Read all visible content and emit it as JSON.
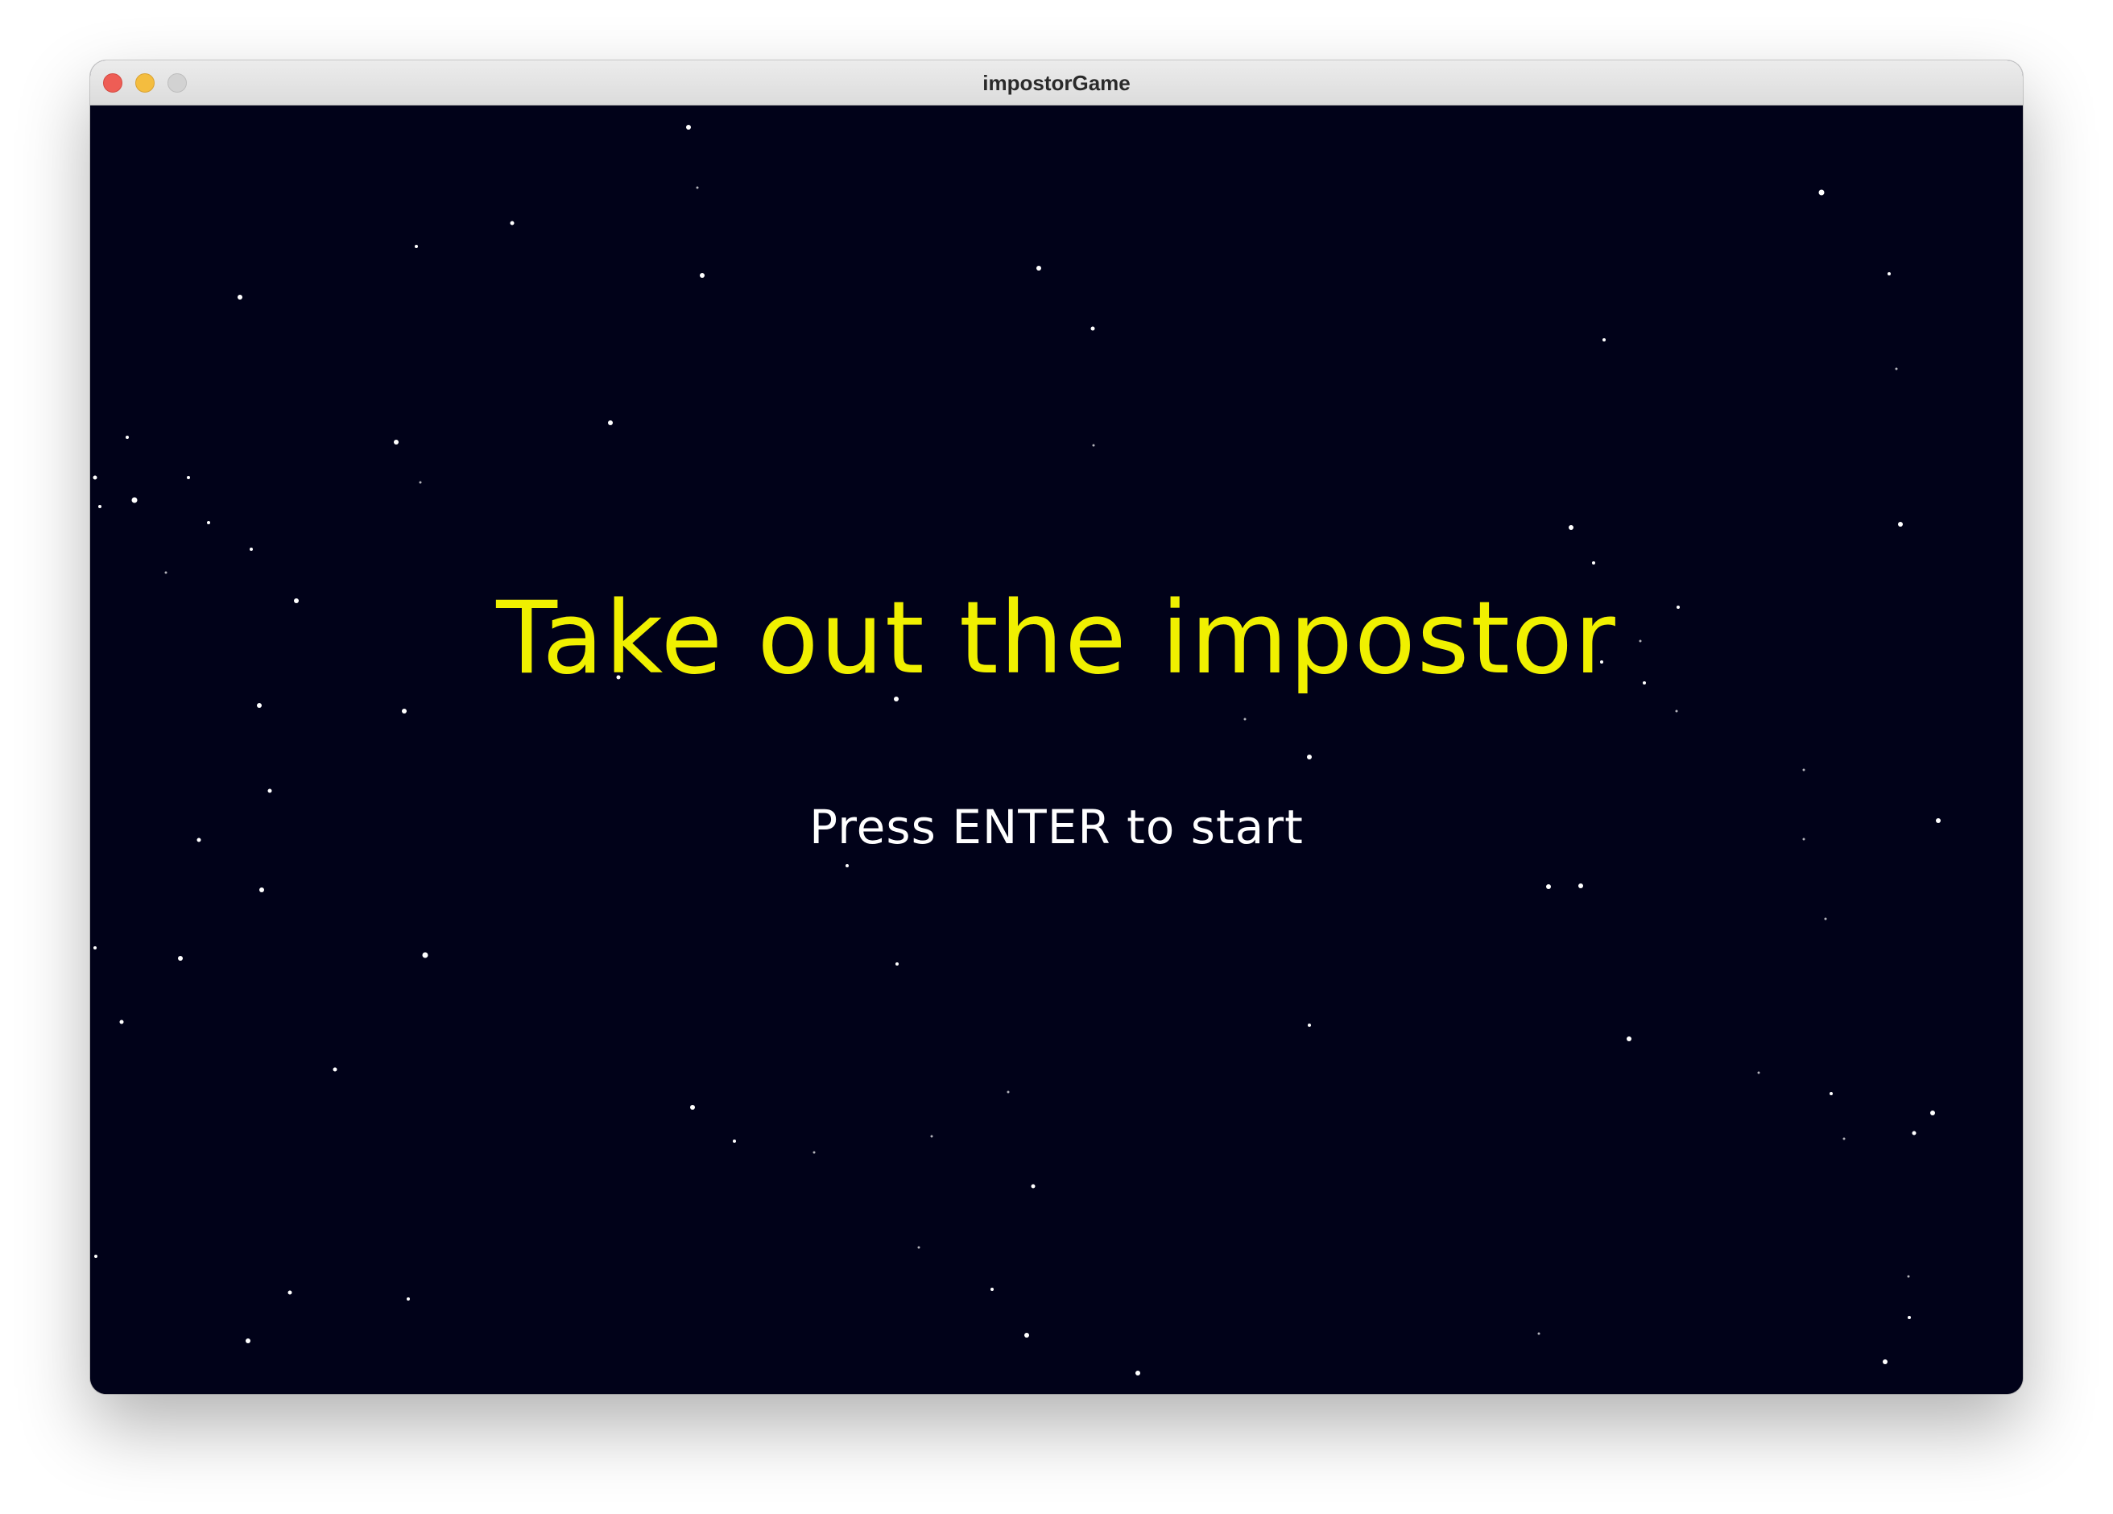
{
  "window": {
    "title": "impostorGame"
  },
  "game": {
    "title": "Take out the impostor",
    "prompt": "Press ENTER to start"
  },
  "colors": {
    "background": "#010219",
    "title_text": "#f0f000",
    "prompt_text": "#ffffff",
    "star": "#ffffff"
  },
  "icons": [
    "close-icon",
    "minimize-icon",
    "zoom-icon"
  ]
}
